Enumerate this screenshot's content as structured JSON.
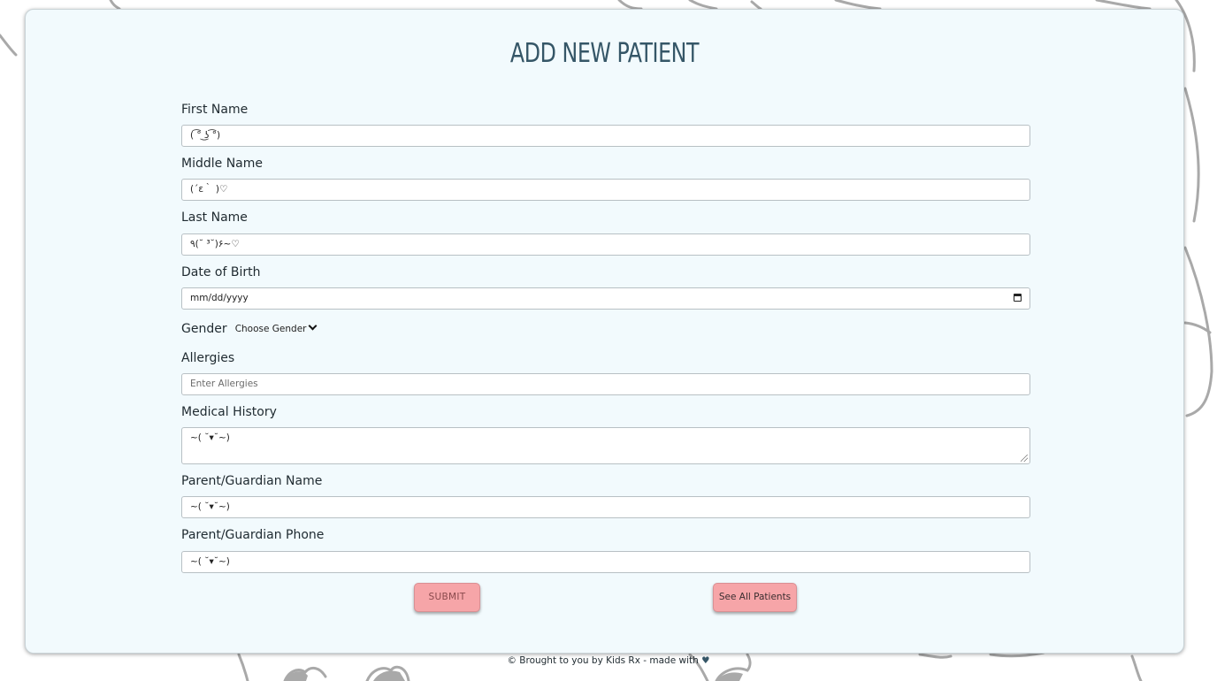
{
  "page": {
    "title": "ADD NEW PATIENT"
  },
  "form": {
    "first_name": {
      "label": "First Name",
      "value": "( ͡° ͜ʖ ͡°)"
    },
    "middle_name": {
      "label": "Middle Name",
      "value": "(´ε｀ )♡"
    },
    "last_name": {
      "label": "Last Name",
      "value": "٩(˘ ³˘)۶~♡"
    },
    "dob": {
      "label": "Date of Birth",
      "placeholder": "mm/dd/yyyy"
    },
    "gender": {
      "label": "Gender",
      "selected": "Choose Gender"
    },
    "allergies": {
      "label": "Allergies",
      "placeholder": "Enter Allergies"
    },
    "medical_history": {
      "label": "Medical History",
      "value": "~( ˘▾˘~)"
    },
    "guardian_name": {
      "label": "Parent/Guardian Name",
      "value": "~( ˘▾˘~)"
    },
    "guardian_phone": {
      "label": "Parent/Guardian Phone",
      "value": "~( ˘▾˘~)"
    }
  },
  "buttons": {
    "submit": "SUBMIT",
    "see_all": "See All Patients"
  },
  "footer": {
    "text": "© Brought to you by Kids Rx - made with",
    "heart": "♥"
  },
  "colors": {
    "card_bg": "#f2fafd",
    "title": "#355667",
    "button_bg": "#f6a5a8"
  }
}
